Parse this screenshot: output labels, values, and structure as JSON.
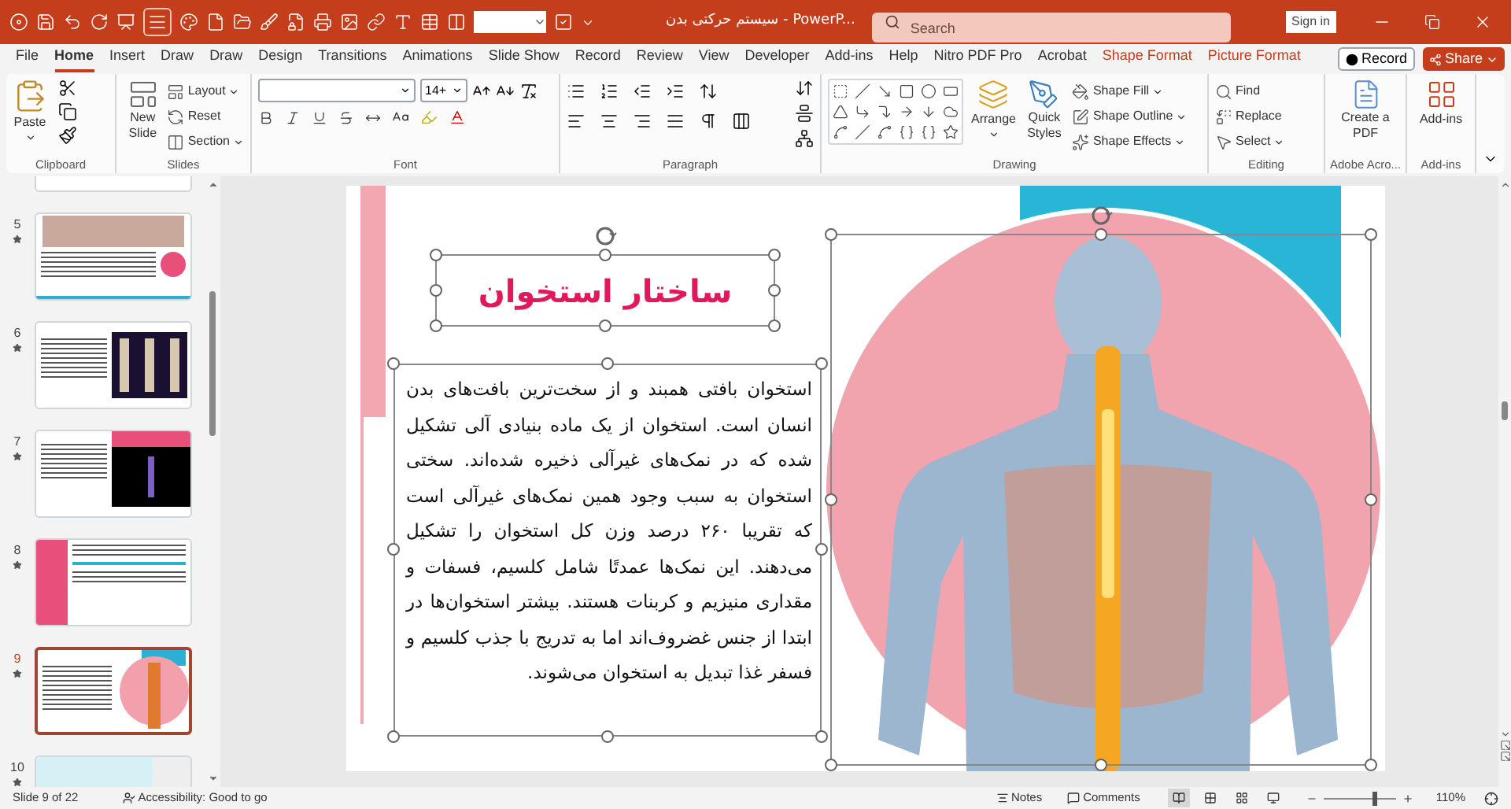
{
  "window": {
    "title": "سیستم حرکتی بدن  -  PowerP...",
    "sign_in": "Sign in"
  },
  "search": {
    "placeholder": "Search"
  },
  "tabs": [
    {
      "label": "File",
      "selected": false,
      "kind": "normal"
    },
    {
      "label": "Home",
      "selected": true,
      "kind": "normal"
    },
    {
      "label": "Insert",
      "selected": false,
      "kind": "normal"
    },
    {
      "label": "Draw",
      "selected": false,
      "kind": "normal"
    },
    {
      "label": "Draw",
      "selected": false,
      "kind": "normal"
    },
    {
      "label": "Design",
      "selected": false,
      "kind": "normal"
    },
    {
      "label": "Transitions",
      "selected": false,
      "kind": "normal"
    },
    {
      "label": "Animations",
      "selected": false,
      "kind": "normal"
    },
    {
      "label": "Slide Show",
      "selected": false,
      "kind": "normal"
    },
    {
      "label": "Record",
      "selected": false,
      "kind": "normal"
    },
    {
      "label": "Review",
      "selected": false,
      "kind": "normal"
    },
    {
      "label": "View",
      "selected": false,
      "kind": "normal"
    },
    {
      "label": "Developer",
      "selected": false,
      "kind": "normal"
    },
    {
      "label": "Add-ins",
      "selected": false,
      "kind": "normal"
    },
    {
      "label": "Help",
      "selected": false,
      "kind": "normal"
    },
    {
      "label": "Nitro PDF Pro",
      "selected": false,
      "kind": "normal"
    },
    {
      "label": "Acrobat",
      "selected": false,
      "kind": "normal"
    },
    {
      "label": "Shape Format",
      "selected": false,
      "kind": "contextual"
    },
    {
      "label": "Picture Format",
      "selected": false,
      "kind": "contextual"
    }
  ],
  "record_button": "Record",
  "share_button": "Share",
  "ribbon": {
    "clipboard": {
      "label": "Clipboard",
      "paste": "Paste"
    },
    "slides": {
      "label": "Slides",
      "new_slide": "New Slide",
      "items": [
        "Layout",
        "Reset",
        "Section"
      ]
    },
    "font": {
      "label": "Font",
      "font_size": "14+"
    },
    "paragraph": {
      "label": "Paragraph"
    },
    "drawing": {
      "label": "Drawing",
      "arrange": "Arrange",
      "quick_styles": "Quick Styles",
      "items": [
        "Shape Fill",
        "Shape Outline",
        "Shape Effects"
      ]
    },
    "editing": {
      "label": "Editing",
      "items": [
        "Find",
        "Replace",
        "Select"
      ]
    },
    "pdf": {
      "label": "Adobe Acro...",
      "button": "Create a PDF"
    },
    "addins": {
      "label": "Add-ins",
      "button": "Add-ins"
    }
  },
  "slides": [
    {
      "kind": "cut-top",
      "selected": false
    },
    {
      "number": "5",
      "kind": "photo",
      "selected": false
    },
    {
      "number": "6",
      "kind": "skeletons",
      "selected": false
    },
    {
      "number": "7",
      "kind": "dark",
      "selected": false
    },
    {
      "number": "8",
      "kind": "pink-side",
      "selected": false
    },
    {
      "number": "9",
      "kind": "spine",
      "selected": true
    },
    {
      "number": "10",
      "kind": "teal",
      "selected": false
    }
  ],
  "slide": {
    "title": "ساختار استخوان",
    "body": "استخوان بافتی همبند و از سخت‌ترین بافت‌های بدن انسان است. استخوان از یک ماده بنیادی آلی تشکیل شده که در نمک‌های غیرآلی ذخیره شده‌اند. سختی استخوان به سبب وجود همین نمک‌های غیرآلی است که تقریبا ۲۶۰ درصد وزن کل استخوان را تشکیل می‌دهند. این نمک‌ها عمدتًا شامل کلسیم، فسفات و مقداری منیزیم و کربنات هستند. بیشتر استخوان‌ها در ابتدا از جنس غضروف‌اند اما به تدریج با جذب کلسیم و فسفر غذا تبدیل به استخوان می‌شوند."
  },
  "status_bar": {
    "slide_info": "Slide 9 of 22",
    "accessibility": "Accessibility: Good to go",
    "notes": "Notes",
    "comments": "Comments",
    "views": [
      {
        "selected": true
      },
      {
        "selected": false
      },
      {
        "selected": false
      },
      {
        "selected": false
      }
    ],
    "zoom": {
      "level": 0.7,
      "reading": "110%"
    }
  }
}
